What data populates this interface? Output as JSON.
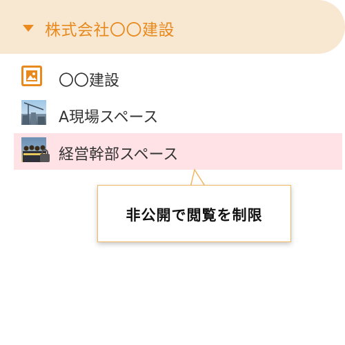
{
  "header": {
    "title": "株式会社〇〇建設",
    "accent_color": "#e8891d",
    "background_color": "#f8e8d2",
    "expand_icon": "caret-down-icon"
  },
  "items": [
    {
      "label": "〇〇建設",
      "icon": "image-icon",
      "selected": false
    },
    {
      "label": "A現場スペース",
      "icon": "construction-photo-icon",
      "selected": false
    },
    {
      "label": "経営幹部スペース",
      "icon": "team-photo-icon",
      "selected": true,
      "locked": true
    }
  ],
  "selection_color": "#ffe2e6",
  "tooltip": {
    "text": "非公開で閲覧を制限",
    "border_color": "#f0b865"
  }
}
